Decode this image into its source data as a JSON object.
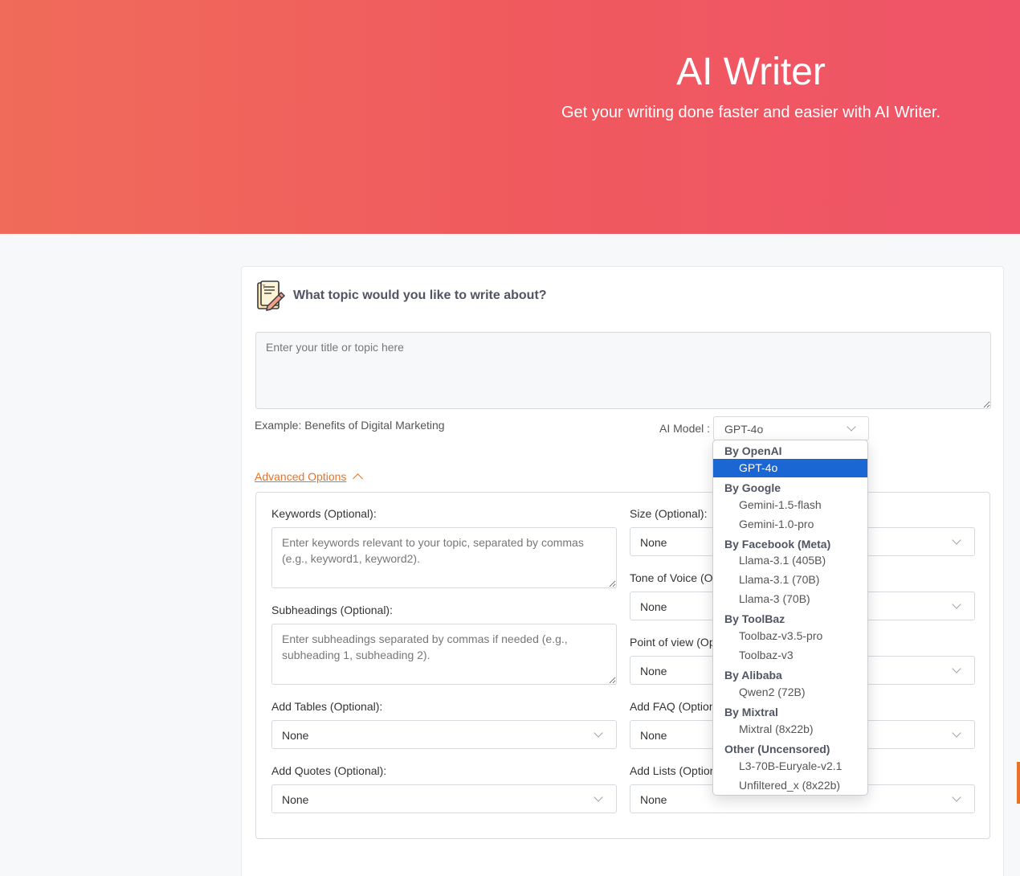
{
  "hero": {
    "title": "AI Writer",
    "subtitle": "Get your writing done faster and easier with AI Writer."
  },
  "topic": {
    "label": "What topic would you like to write about?",
    "placeholder": "Enter your title or topic here",
    "example": "Example: Benefits of Digital Marketing"
  },
  "model": {
    "label": "AI Model :",
    "selected": "GPT-4o",
    "groups": [
      {
        "label": "By OpenAI",
        "options": [
          "GPT-4o"
        ]
      },
      {
        "label": "By Google",
        "options": [
          "Gemini-1.5-flash",
          "Gemini-1.0-pro"
        ]
      },
      {
        "label": "By Facebook (Meta)",
        "options": [
          "Llama-3.1 (405B)",
          "Llama-3.1 (70B)",
          "Llama-3 (70B)"
        ]
      },
      {
        "label": "By ToolBaz",
        "options": [
          "Toolbaz-v3.5-pro",
          "Toolbaz-v3"
        ]
      },
      {
        "label": "By Alibaba",
        "options": [
          "Qwen2 (72B)"
        ]
      },
      {
        "label": "By Mixtral",
        "options": [
          "Mixtral (8x22b)"
        ]
      },
      {
        "label": "Other (Uncensored)",
        "options": [
          "L3-70B-Euryale-v2.1",
          "Unfiltered_x (8x22b)"
        ]
      }
    ]
  },
  "advanced": {
    "toggle_label": "Advanced Options",
    "keywords": {
      "label": "Keywords (Optional):",
      "placeholder": "Enter keywords relevant to your topic, separated by commas (e.g., keyword1, keyword2)."
    },
    "subheadings": {
      "label": "Subheadings (Optional):",
      "placeholder": "Enter subheadings separated by commas if needed (e.g., subheading 1, subheading 2)."
    },
    "tables": {
      "label": "Add Tables (Optional):",
      "value": "None"
    },
    "quotes": {
      "label": "Add Quotes (Optional):",
      "value": "None"
    },
    "size": {
      "label": "Size (Optional):",
      "value": "None"
    },
    "tone": {
      "label": "Tone of Voice (Op",
      "value": "None"
    },
    "pov": {
      "label": "Point of view (Op",
      "value": "None"
    },
    "faq": {
      "label": "Add FAQ (Option",
      "value": "None"
    },
    "lists": {
      "label": "Add Lists (Option",
      "value": "None"
    }
  },
  "colors": {
    "accent": "#e8722a",
    "selected": "#1a66d2",
    "hero_start": "#f06b5a",
    "hero_end": "#ef5468"
  }
}
